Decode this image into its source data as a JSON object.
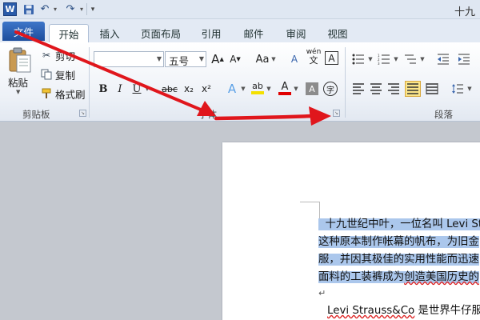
{
  "titlebar": {
    "logo_letter": "W",
    "window_title": "十九"
  },
  "tabs": [
    {
      "label": "文件"
    },
    {
      "label": "开始"
    },
    {
      "label": "插入"
    },
    {
      "label": "页面布局"
    },
    {
      "label": "引用"
    },
    {
      "label": "邮件"
    },
    {
      "label": "审阅"
    },
    {
      "label": "视图"
    }
  ],
  "clipboard": {
    "paste_label": "粘贴",
    "cut_label": "剪切",
    "copy_label": "复制",
    "format_painter_label": "格式刷",
    "group_label": "剪贴板"
  },
  "font": {
    "font_name_value": "",
    "font_size_value": "五号",
    "group_label": "字体",
    "grow_glyph": "A",
    "shrink_glyph": "A",
    "case_glyph": "Aa",
    "clear_glyph": "A",
    "phonetic_glyph": "wén",
    "border_glyph": "A",
    "bold_glyph": "B",
    "italic_glyph": "I",
    "underline_glyph": "U",
    "strike_glyph": "abc",
    "subscript_glyph": "x₂",
    "superscript_glyph": "x²",
    "effect_glyph": "A",
    "highlight_glyph": "ab",
    "color_glyph": "A",
    "shading_glyph": "A",
    "enclose_glyph": "字",
    "highlight_color": "#f4e000",
    "font_color": "#e00000"
  },
  "paragraph": {
    "group_label": "段落"
  },
  "document": {
    "lines": [
      "十九世纪中叶，一位名叫 Levi St",
      "这种原本制作帐幕的帆布，为旧金",
      "服，并因其极佳的实用性能而迅速",
      "面料的工装裤成为"
    ],
    "line4_tail_squiggle": "创造美国历史的",
    "para2_prefix": "Levi Strauss&Co",
    "para2_rest": " 是世界牛仔服的"
  },
  "annotation_color": "#e0161c"
}
